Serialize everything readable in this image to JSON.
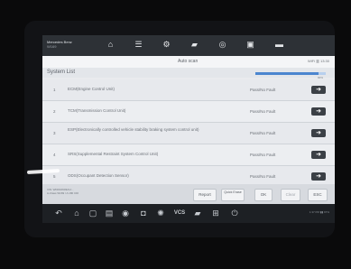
{
  "header": {
    "brand_title": "Mercedes Benz",
    "brand_subtitle": "W169",
    "icons": [
      "home-icon",
      "vehicle-icon",
      "settings-icon",
      "car-icon",
      "browser-icon",
      "print-icon",
      "help-icon"
    ]
  },
  "subheader": {
    "title": "Auto scan",
    "status": "WiFi ▥ 13:30"
  },
  "list": {
    "title": "System List",
    "progress_percent": 90,
    "progress_label": "90%",
    "rows": [
      {
        "num": "1",
        "name": "ECM(Engine Control Unit)",
        "result": "Pass/No Fault"
      },
      {
        "num": "2",
        "name": "TCM(Transmission Control Unit)",
        "result": "Pass/No Fault"
      },
      {
        "num": "3",
        "name": "ESP(Electronically controlled vehicle stability braking system control unit)",
        "result": "Pass/No Fault"
      },
      {
        "num": "4",
        "name": "SRS(Supplemental Restraint System Control Unit)",
        "result": "Pass/No Fault"
      },
      {
        "num": "5",
        "name": "ODS(Occupant Detection Sensor)",
        "result": "Pass/No Fault"
      }
    ]
  },
  "footer": {
    "vehicle_line1": "VIN: WDD1690321J...",
    "vehicle_line2": "A-Class W169 / A 180 CDI",
    "buttons": {
      "report": "Report",
      "quick_erase": "Quick Erase",
      "ok": "OK",
      "clear": "Clear",
      "esc": "ESC"
    }
  },
  "navbar": {
    "vcs_label": "VCS",
    "status_text": "1:37 PM ▮▮ 97%"
  }
}
